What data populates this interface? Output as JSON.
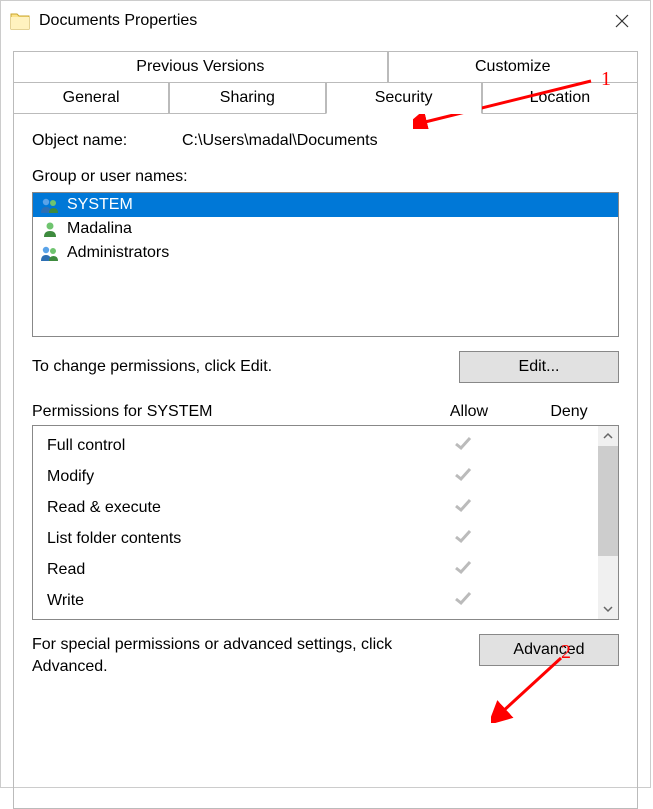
{
  "window": {
    "title": "Documents Properties"
  },
  "tabs": {
    "row1": [
      "Previous Versions",
      "Customize"
    ],
    "row2": [
      "General",
      "Sharing",
      "Security",
      "Location"
    ],
    "active": "Security"
  },
  "security": {
    "object_name_label": "Object name:",
    "object_name_value": "C:\\Users\\madal\\Documents",
    "groups_label": "Group or user names:",
    "groups": [
      {
        "name": "SYSTEM",
        "icon": "two-users"
      },
      {
        "name": "Madalina",
        "icon": "single-user"
      },
      {
        "name": "Administrators",
        "icon": "two-users"
      }
    ],
    "selected_group_index": 0,
    "edit_text": "To change permissions, click Edit.",
    "edit_button": "Edit...",
    "permissions_label": "Permissions for SYSTEM",
    "allow_label": "Allow",
    "deny_label": "Deny",
    "permissions": [
      {
        "name": "Full control",
        "allow": true,
        "deny": false
      },
      {
        "name": "Modify",
        "allow": true,
        "deny": false
      },
      {
        "name": "Read & execute",
        "allow": true,
        "deny": false
      },
      {
        "name": "List folder contents",
        "allow": true,
        "deny": false
      },
      {
        "name": "Read",
        "allow": true,
        "deny": false
      },
      {
        "name": "Write",
        "allow": true,
        "deny": false
      }
    ],
    "advanced_text": "For special permissions or advanced settings, click Advanced.",
    "advanced_button": "Advanced"
  },
  "annotations": {
    "n1": "1",
    "n2": "2"
  }
}
